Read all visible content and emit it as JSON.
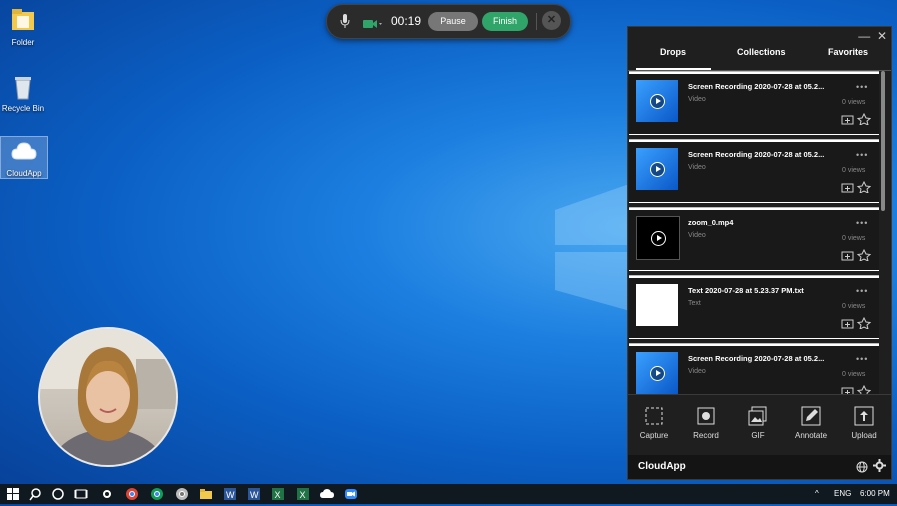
{
  "desktop": {
    "icons": [
      {
        "label": "Folder"
      },
      {
        "label": "Recycle Bin"
      },
      {
        "label": "CloudApp"
      }
    ]
  },
  "recorder": {
    "timer": "00:19",
    "pause_label": "Pause",
    "finish_label": "Finish"
  },
  "panel": {
    "tabs": [
      {
        "label": "Drops"
      },
      {
        "label": "Collections"
      },
      {
        "label": "Favorites"
      }
    ],
    "items": [
      {
        "title": "Screen Recording 2020-07-28 at 05.2...",
        "type": "Video",
        "views": "0 views",
        "thumb": "blue"
      },
      {
        "title": "Screen Recording 2020-07-28 at 05.2...",
        "type": "Video",
        "views": "0 views",
        "thumb": "blue"
      },
      {
        "title": "zoom_0.mp4",
        "type": "Video",
        "views": "0 views",
        "thumb": "black"
      },
      {
        "title": "Text 2020-07-28 at 5.23.37 PM.txt",
        "type": "Text",
        "views": "0 views",
        "thumb": "white"
      },
      {
        "title": "Screen Recording 2020-07-28 at 05.2...",
        "type": "Video",
        "views": "0 views",
        "thumb": "blue"
      }
    ],
    "tools": [
      {
        "label": "Capture"
      },
      {
        "label": "Record"
      },
      {
        "label": "GIF"
      },
      {
        "label": "Annotate"
      },
      {
        "label": "Upload"
      }
    ],
    "footer_brand": "CloudApp"
  },
  "taskbar": {
    "language": "ENG",
    "time": "6:00 PM"
  }
}
